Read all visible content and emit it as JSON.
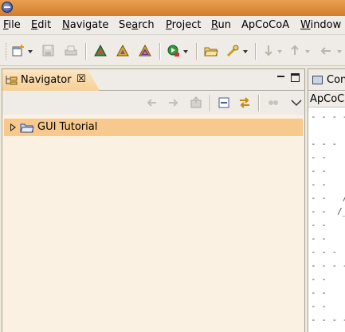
{
  "window": {
    "app_icon": "eclipse-icon"
  },
  "menu": [
    {
      "label": "File",
      "u": "F",
      "rest": "ile"
    },
    {
      "label": "Edit",
      "u": "E",
      "rest": "dit"
    },
    {
      "label": "Navigate",
      "u": "N",
      "rest": "avigate"
    },
    {
      "label": "Search",
      "pre": "Se",
      "u": "a",
      "rest": "rch"
    },
    {
      "label": "Project",
      "u": "P",
      "rest": "roject"
    },
    {
      "label": "Run",
      "u": "R",
      "rest": "un"
    },
    {
      "label": "ApCoCoA",
      "plain": "ApCoCoA"
    },
    {
      "label": "Window",
      "u": "W",
      "rest": "indow"
    }
  ],
  "toolbar": {
    "icons": [
      "new-wizard-icon",
      "save-icon",
      "print-icon",
      "apcocoa-icon-1",
      "apcocoa-icon-2",
      "apcocoa-icon-3",
      "run-icon",
      "open-folder-icon",
      "search-tool-icon",
      "next-annotation-icon",
      "prev-annotation-icon",
      "back-icon"
    ]
  },
  "navigator": {
    "tab_label": "Navigator",
    "close_glyph": "☒",
    "tree": [
      {
        "label": "GUI Tutorial",
        "expanded": false,
        "selected": true
      }
    ]
  },
  "console": {
    "tab_label": "Console",
    "header_label": "ApCoCoA",
    "lines": [
      "- - - - - - - -",
      "",
      "- - -",
      "- -",
      "- -",
      "- -",
      "- -   /",
      "- -  /_",
      "- -",
      "- -",
      "- - -",
      "- - - - - - - -",
      "- -",
      "- -",
      "- -",
      "- - - - - - - -"
    ]
  },
  "colors": {
    "accent": "#f8c98c",
    "titlebar": "#d27d2e",
    "tab_active": "#f6cf95"
  }
}
